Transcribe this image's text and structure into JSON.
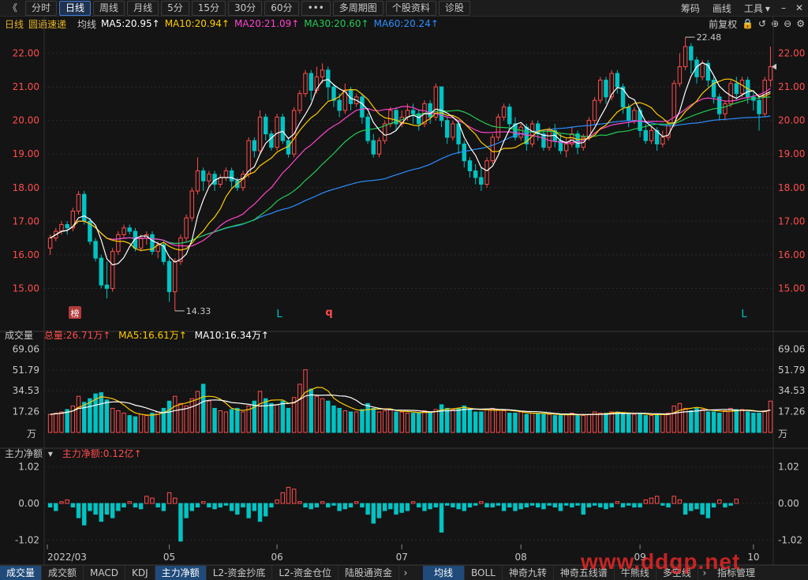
{
  "toolbar": {
    "back": "《",
    "buttons": [
      "分时",
      "日线",
      "周线",
      "月线",
      "5分",
      "15分",
      "30分",
      "60分",
      "•••",
      "多周期图",
      "个股资料",
      "诊股"
    ],
    "active": "日线",
    "right": [
      "筹码",
      "画线",
      "工具"
    ],
    "right_extra": "▾"
  },
  "info": {
    "period": "日线",
    "stock": "圆通速递",
    "ma_label": "均线",
    "ma5": "MA5:20.95↑",
    "ma10": "MA10:20.94↑",
    "ma20": "MA20:21.09↑",
    "ma30": "MA30:20.60↑",
    "ma60": "MA60:20.24↑",
    "adjust": "前复权"
  },
  "colors": {
    "up": "#ff4d4d",
    "down": "#00c3c3",
    "ma5": "#ffffff",
    "ma10": "#ffcc00",
    "ma20": "#ff44cc",
    "ma30": "#22cc55",
    "ma60": "#2a8fff",
    "accent": "#3e7cd6"
  },
  "price_axis": [
    "22.00",
    "21.00",
    "20.00",
    "19.00",
    "18.00",
    "17.00",
    "16.00",
    "15.00"
  ],
  "price_marks": {
    "high": "22.48",
    "low": "14.33",
    "badge": "榜",
    "tag_l1": "L",
    "tag_q": "q",
    "tag_l2": "L"
  },
  "volume": {
    "title": "成交量",
    "total": "总量:26.71万↑",
    "ma5": "MA5:16.61万↑",
    "ma10": "MA10:16.34万↑",
    "axis": [
      "69.06",
      "51.79",
      "34.53",
      "17.26"
    ],
    "unit": "万"
  },
  "flow": {
    "title": "主力净额",
    "value": "主力净额:0.12亿↑",
    "axis": [
      "1.02",
      "0.00",
      "-1.02"
    ]
  },
  "date_axis": [
    "2022/03",
    "05",
    "06",
    "07",
    "08",
    "09",
    "10"
  ],
  "bottom_tabs": [
    "成交量",
    "成交额",
    "MACD",
    "KDJ",
    "主力净额",
    "L2-资金抄底",
    "L2-资金仓位",
    "陆股通资金"
  ],
  "bottom_tabs_right": [
    "均线",
    "BOLL",
    "神奇九转",
    "神奇五线谱",
    "牛熊线",
    "多空线",
    "指标管理"
  ],
  "bottom_active_left": [
    "成交量",
    "主力净额"
  ],
  "bottom_active_right": "均线",
  "watermark": "www.ddgp.net",
  "chart_data": {
    "type": "candlestick",
    "price_range": [
      14.0,
      22.6
    ],
    "volume_range": [
      0,
      72
    ],
    "flow_range": [
      -1.1,
      1.1
    ],
    "candles": [
      [
        16.2,
        16.5,
        16.0,
        16.6
      ],
      [
        16.5,
        16.7,
        16.4,
        16.8
      ],
      [
        16.7,
        16.9,
        16.6,
        17.0
      ],
      [
        16.9,
        16.8,
        16.6,
        17.0
      ],
      [
        16.8,
        17.3,
        16.7,
        17.4
      ],
      [
        17.3,
        17.8,
        17.2,
        17.9
      ],
      [
        17.8,
        17.0,
        16.9,
        17.9
      ],
      [
        17.0,
        16.4,
        16.3,
        17.1
      ],
      [
        16.4,
        15.9,
        15.8,
        16.5
      ],
      [
        15.9,
        15.1,
        15.0,
        16.0
      ],
      [
        15.1,
        15.0,
        14.7,
        15.8
      ],
      [
        15.0,
        16.1,
        14.9,
        16.2
      ],
      [
        16.1,
        16.6,
        16.0,
        16.7
      ],
      [
        16.6,
        16.8,
        16.5,
        16.9
      ],
      [
        16.8,
        16.7,
        16.6,
        16.9
      ],
      [
        16.7,
        16.2,
        16.1,
        16.8
      ],
      [
        16.2,
        16.5,
        16.1,
        16.6
      ],
      [
        16.5,
        16.6,
        16.3,
        16.7
      ],
      [
        16.6,
        16.1,
        16.0,
        16.7
      ],
      [
        16.1,
        16.3,
        15.9,
        16.4
      ],
      [
        16.3,
        15.8,
        15.7,
        16.4
      ],
      [
        15.8,
        14.9,
        14.6,
        15.9
      ],
      [
        14.9,
        15.8,
        14.33,
        15.9
      ],
      [
        15.8,
        16.5,
        15.7,
        16.6
      ],
      [
        16.5,
        17.1,
        16.4,
        17.2
      ],
      [
        17.1,
        17.9,
        17.0,
        18.0
      ],
      [
        17.9,
        18.5,
        17.8,
        18.9
      ],
      [
        18.5,
        18.2,
        17.9,
        18.6
      ],
      [
        18.2,
        18.4,
        18.0,
        18.5
      ],
      [
        18.4,
        18.1,
        17.9,
        18.5
      ],
      [
        18.1,
        18.3,
        18.0,
        18.4
      ],
      [
        18.3,
        18.5,
        18.2,
        18.6
      ],
      [
        18.5,
        18.2,
        18.0,
        18.6
      ],
      [
        18.2,
        18.0,
        17.9,
        18.3
      ],
      [
        18.0,
        18.4,
        17.9,
        18.5
      ],
      [
        18.4,
        19.4,
        18.3,
        19.5
      ],
      [
        19.4,
        19.1,
        18.9,
        19.5
      ],
      [
        19.1,
        20.1,
        19.0,
        20.3
      ],
      [
        20.1,
        19.6,
        19.4,
        20.2
      ],
      [
        19.6,
        19.2,
        19.1,
        19.7
      ],
      [
        19.2,
        20.1,
        19.1,
        20.2
      ],
      [
        20.1,
        19.4,
        19.3,
        20.2
      ],
      [
        19.4,
        19.0,
        18.9,
        19.5
      ],
      [
        19.0,
        20.3,
        18.9,
        20.4
      ],
      [
        20.3,
        20.8,
        20.2,
        20.9
      ],
      [
        20.8,
        21.4,
        20.7,
        21.5
      ],
      [
        21.4,
        20.9,
        20.6,
        21.5
      ],
      [
        20.9,
        21.3,
        20.8,
        21.6
      ],
      [
        21.3,
        21.5,
        21.1,
        21.7
      ],
      [
        21.5,
        21.0,
        20.6,
        21.6
      ],
      [
        21.0,
        20.6,
        20.4,
        21.1
      ],
      [
        20.6,
        20.3,
        20.1,
        20.8
      ],
      [
        20.3,
        20.9,
        20.2,
        21.1
      ],
      [
        20.9,
        20.5,
        20.3,
        21.0
      ],
      [
        20.5,
        20.7,
        20.4,
        20.8
      ],
      [
        20.7,
        20.1,
        19.9,
        20.8
      ],
      [
        20.1,
        19.4,
        19.3,
        20.2
      ],
      [
        19.4,
        19.0,
        18.9,
        19.6
      ],
      [
        19.0,
        19.4,
        18.9,
        19.5
      ],
      [
        19.4,
        19.9,
        19.3,
        20.0
      ],
      [
        19.9,
        20.3,
        19.8,
        20.4
      ],
      [
        20.3,
        19.9,
        19.7,
        20.4
      ],
      [
        19.9,
        20.1,
        19.8,
        20.3
      ],
      [
        20.1,
        20.3,
        20.0,
        20.5
      ],
      [
        20.3,
        20.2,
        19.9,
        20.5
      ],
      [
        20.2,
        19.9,
        19.7,
        20.3
      ],
      [
        19.9,
        20.5,
        19.8,
        20.6
      ],
      [
        20.5,
        20.1,
        19.9,
        20.6
      ],
      [
        20.1,
        21.0,
        20.0,
        21.1
      ],
      [
        21.0,
        20.0,
        19.8,
        21.0
      ],
      [
        20.0,
        19.5,
        19.3,
        20.1
      ],
      [
        19.5,
        19.9,
        19.4,
        20.0
      ],
      [
        19.9,
        19.3,
        19.0,
        20.0
      ],
      [
        19.3,
        18.8,
        18.6,
        19.4
      ],
      [
        18.8,
        18.5,
        18.3,
        18.9
      ],
      [
        18.5,
        18.3,
        18.1,
        18.7
      ],
      [
        18.3,
        18.1,
        17.9,
        18.6
      ],
      [
        18.1,
        18.8,
        18.0,
        18.9
      ],
      [
        18.8,
        19.5,
        18.7,
        19.6
      ],
      [
        19.5,
        20.1,
        19.4,
        20.2
      ],
      [
        20.1,
        20.4,
        20.0,
        20.5
      ],
      [
        20.4,
        19.9,
        19.7,
        20.5
      ],
      [
        19.9,
        19.5,
        19.4,
        20.1
      ],
      [
        19.5,
        19.8,
        19.4,
        19.9
      ],
      [
        19.8,
        19.3,
        19.1,
        19.9
      ],
      [
        19.3,
        19.9,
        19.2,
        20.0
      ],
      [
        19.9,
        19.6,
        19.4,
        20.0
      ],
      [
        19.6,
        19.2,
        19.1,
        19.7
      ],
      [
        19.2,
        19.7,
        19.1,
        19.8
      ],
      [
        19.7,
        19.4,
        19.2,
        19.9
      ],
      [
        19.4,
        19.1,
        19.0,
        19.6
      ],
      [
        19.1,
        19.3,
        18.9,
        19.5
      ],
      [
        19.3,
        19.6,
        19.2,
        19.8
      ],
      [
        19.6,
        19.2,
        19.0,
        19.7
      ],
      [
        19.2,
        19.5,
        19.1,
        19.6
      ],
      [
        19.5,
        20.0,
        19.4,
        20.1
      ],
      [
        20.0,
        20.6,
        19.9,
        20.7
      ],
      [
        20.6,
        21.2,
        20.5,
        21.3
      ],
      [
        21.2,
        20.7,
        20.5,
        21.3
      ],
      [
        20.7,
        21.4,
        20.6,
        21.5
      ],
      [
        21.4,
        21.0,
        20.8,
        21.5
      ],
      [
        21.0,
        20.4,
        20.2,
        21.1
      ],
      [
        20.4,
        20.0,
        19.8,
        20.5
      ],
      [
        20.0,
        20.3,
        19.9,
        20.4
      ],
      [
        20.3,
        19.7,
        19.5,
        20.4
      ],
      [
        19.7,
        19.4,
        19.3,
        19.9
      ],
      [
        19.4,
        19.7,
        19.3,
        19.8
      ],
      [
        19.7,
        19.3,
        19.1,
        19.8
      ],
      [
        19.3,
        19.5,
        19.2,
        19.7
      ],
      [
        19.5,
        19.9,
        19.4,
        20.0
      ],
      [
        19.9,
        21.1,
        19.8,
        21.2
      ],
      [
        21.1,
        21.6,
        21.0,
        22.0
      ],
      [
        21.6,
        22.2,
        21.5,
        22.48
      ],
      [
        22.2,
        21.8,
        21.4,
        22.3
      ],
      [
        21.8,
        21.3,
        21.1,
        21.9
      ],
      [
        21.3,
        21.7,
        21.2,
        21.8
      ],
      [
        21.7,
        21.2,
        21.0,
        21.8
      ],
      [
        21.2,
        20.7,
        20.5,
        21.3
      ],
      [
        20.7,
        20.2,
        20.0,
        20.8
      ],
      [
        20.2,
        20.5,
        20.0,
        20.6
      ],
      [
        20.5,
        21.1,
        20.4,
        21.2
      ],
      [
        21.1,
        20.8,
        20.6,
        21.3
      ],
      [
        20.8,
        21.2,
        20.7,
        21.3
      ],
      [
        21.2,
        20.7,
        20.5,
        21.3
      ],
      [
        20.7,
        20.6,
        20.3,
        20.9
      ],
      [
        20.6,
        20.2,
        19.7,
        20.7
      ],
      [
        20.2,
        21.2,
        20.1,
        21.3
      ],
      [
        21.2,
        21.6,
        21.0,
        22.2
      ]
    ],
    "volumes": [
      15,
      16,
      17,
      19,
      22,
      30,
      25,
      28,
      32,
      33,
      27,
      20,
      18,
      16,
      14,
      13,
      15,
      14,
      16,
      17,
      20,
      26,
      30,
      24,
      22,
      28,
      34,
      40,
      26,
      20,
      18,
      17,
      19,
      20,
      17,
      22,
      26,
      34,
      28,
      24,
      23,
      26,
      20,
      29,
      40,
      52,
      36,
      30,
      28,
      26,
      22,
      20,
      18,
      17,
      17,
      19,
      24,
      20,
      17,
      18,
      19,
      17,
      17,
      16,
      16,
      16,
      18,
      17,
      19,
      23,
      20,
      19,
      20,
      22,
      19,
      17,
      17,
      19,
      20,
      19,
      18,
      16,
      16,
      17,
      15,
      16,
      16,
      15,
      15,
      14,
      14,
      15,
      16,
      14,
      14,
      15,
      17,
      16,
      16,
      17,
      17,
      16,
      15,
      15,
      16,
      14,
      14,
      15,
      15,
      16,
      22,
      24,
      20,
      18,
      20,
      19,
      17,
      17,
      16,
      18,
      20,
      19,
      19,
      17,
      16,
      16,
      18,
      26
    ],
    "flow": [
      -0.1,
      -0.2,
      0.05,
      0.1,
      -0.1,
      -0.4,
      -0.6,
      -0.2,
      -0.3,
      -0.5,
      -0.3,
      -0.4,
      -0.2,
      -0.1,
      0.05,
      -0.1,
      -0.15,
      0.2,
      0.15,
      -0.1,
      -0.2,
      0.3,
      0.15,
      -1.05,
      -0.4,
      -0.2,
      -0.1,
      0.05,
      -0.1,
      -0.15,
      -0.1,
      -0.05,
      -0.2,
      -0.3,
      -0.1,
      -0.4,
      -0.2,
      -0.5,
      -0.35,
      -0.1,
      0.1,
      0.3,
      0.45,
      0.4,
      0.05,
      -0.1,
      -0.15,
      -0.1,
      0.05,
      -0.1,
      -0.05,
      -0.2,
      -0.15,
      -0.1,
      0.05,
      -0.1,
      -0.3,
      -0.55,
      -0.4,
      -0.2,
      -0.15,
      -0.3,
      -0.25,
      -0.2,
      0.05,
      -0.1,
      -0.2,
      -0.15,
      -0.1,
      -0.8,
      -0.05,
      -0.1,
      -0.15,
      -0.2,
      -0.1,
      -0.05,
      0.05,
      -0.1,
      -0.1,
      -0.05,
      -0.2,
      -0.1,
      -0.2,
      -0.15,
      -0.1,
      -0.05,
      -0.1,
      -0.15,
      -0.05,
      -0.1,
      -0.2,
      -0.05,
      -0.1,
      -0.05,
      -0.3,
      -0.1,
      -0.05,
      -0.1,
      -0.15,
      -0.1,
      0.05,
      -0.1,
      -0.05,
      -0.1,
      -0.1,
      0.1,
      0.15,
      0.2,
      -0.05,
      -0.1,
      0.2,
      0.1,
      -0.3,
      -0.2,
      -0.15,
      -0.3,
      -0.4,
      -0.1,
      0.1,
      -0.1,
      -0.05,
      0.12
    ]
  }
}
